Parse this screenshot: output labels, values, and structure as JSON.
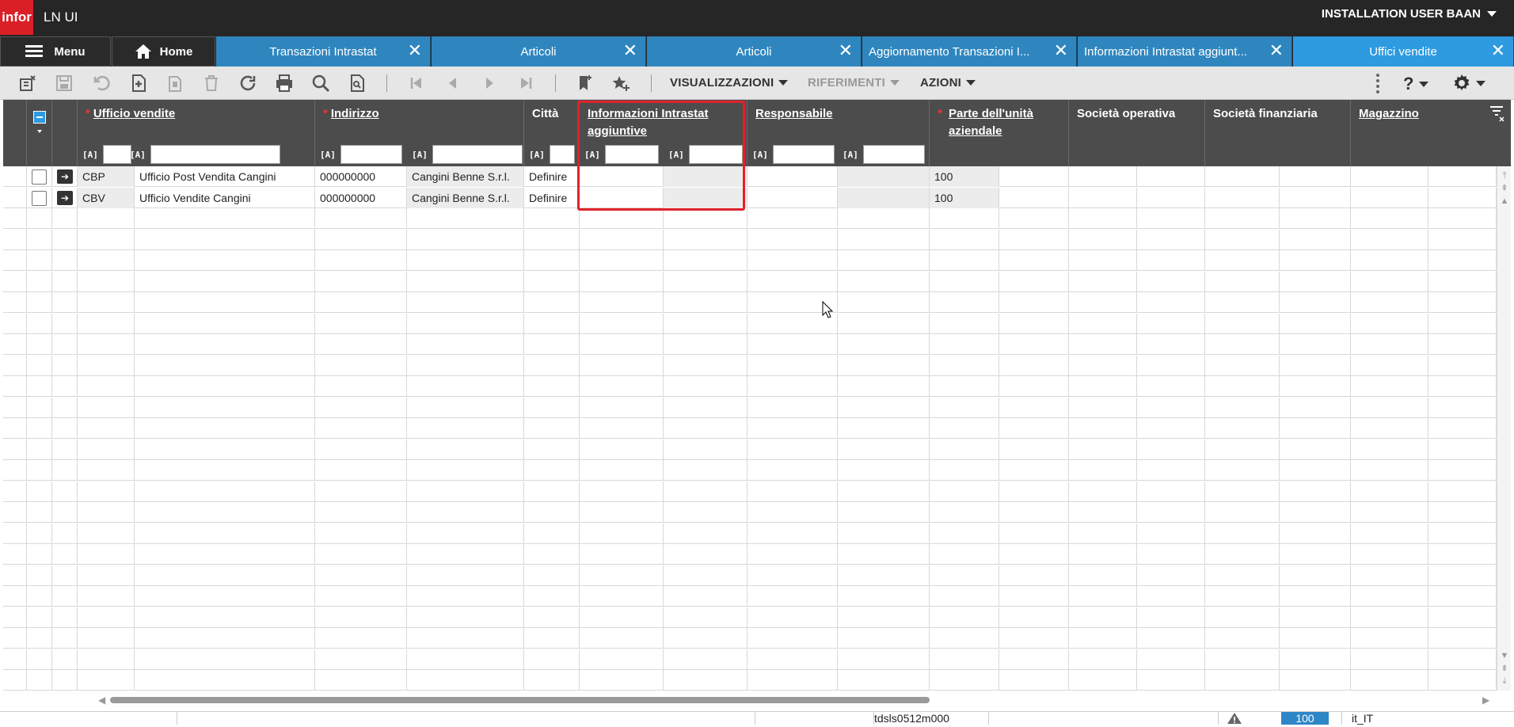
{
  "app": {
    "logo": "infor",
    "title": "LN UI",
    "user": "INSTALLATION USER BAAN"
  },
  "tabs": [
    {
      "label": "Menu",
      "kind": "menu"
    },
    {
      "label": "Home",
      "kind": "home"
    },
    {
      "label": "Transazioni Intrastat",
      "close": "✕"
    },
    {
      "label": "Articoli",
      "close": "✕"
    },
    {
      "label": "Articoli",
      "close": "✕"
    },
    {
      "label": "Aggiornamento Transazioni I...",
      "close": "✕"
    },
    {
      "label": "Informazioni Intrastat aggiunt...",
      "close": "✕"
    },
    {
      "label": "Uffici vendite",
      "close": "✕",
      "active": true
    }
  ],
  "toolbar": {
    "views_label": "VISUALIZZAZIONI",
    "references_label": "RIFERIMENTI",
    "actions_label": "AZIONI",
    "help_label": "?"
  },
  "grid": {
    "filter_badge": "[A]",
    "columns": [
      {
        "title": "Ufficio vendite",
        "required": true,
        "underline": true
      },
      {
        "title": "Indirizzo",
        "required": true,
        "underline": true
      },
      {
        "title": "Città",
        "required": false,
        "underline": false
      },
      {
        "title": "Informazioni Intrastat aggiuntive",
        "required": false,
        "underline": true
      },
      {
        "title": "Responsabile",
        "required": false,
        "underline": true
      },
      {
        "title": "Parte dell'unità aziendale",
        "required": true,
        "underline": true
      },
      {
        "title": "Società operativa",
        "required": false,
        "underline": false
      },
      {
        "title": "Società finanziaria",
        "required": false,
        "underline": false
      },
      {
        "title": "Magazzino",
        "required": false,
        "underline": true
      }
    ],
    "rows": [
      {
        "code": "CBP",
        "name": "Ufficio Post Vendita Cangini",
        "address": "000000000",
        "address_name": "Cangini Benne S.r.l.",
        "city": "Definire",
        "intrastat_1": "",
        "intrastat_2": "",
        "manager_1": "",
        "manager_2": "",
        "unit": "100"
      },
      {
        "code": "CBV",
        "name": "Ufficio Vendite Cangini",
        "address": "000000000",
        "address_name": "Cangini Benne S.r.l.",
        "city": "Definire",
        "intrastat_1": "",
        "intrastat_2": "",
        "manager_1": "",
        "manager_2": "",
        "unit": "100"
      }
    ]
  },
  "status": {
    "session": "tdsls0512m000",
    "company": "100",
    "locale": "it_IT"
  },
  "colors": {
    "brand": "#da1f26",
    "tab_blue": "#2f86bf",
    "tab_active": "#2e9ae0",
    "header_bg": "#4c4c4c",
    "highlight": "#e0222b"
  }
}
